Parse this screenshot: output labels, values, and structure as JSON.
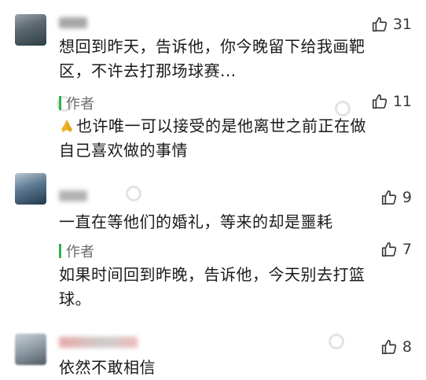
{
  "comments": [
    {
      "likes": "31",
      "text_lines": [
        "想回到昨天，告诉他，你今晚留下给我画靶",
        "区，不许去打那场球赛..."
      ],
      "reply": {
        "author_label": "作者",
        "likes": "11",
        "emoji": "folded-hands",
        "text_lines": [
          "也许唯一可以接受的是他离世之前正在做",
          "自己喜欢做的事情"
        ]
      }
    },
    {
      "likes": "9",
      "text_lines": [
        "一直在等他们的婚礼，等来的却是噩耗"
      ],
      "reply": {
        "author_label": "作者",
        "likes": "7",
        "text_lines": [
          "如果时间回到昨晚，告诉他，今天别去打篮",
          "球。"
        ]
      }
    },
    {
      "likes": "8",
      "text_lines": [
        "依然不敢相信"
      ]
    }
  ],
  "colors": {
    "author_bar": "#2fb34a",
    "like_icon": "#3a3a3a",
    "text": "#1a1a1a"
  }
}
